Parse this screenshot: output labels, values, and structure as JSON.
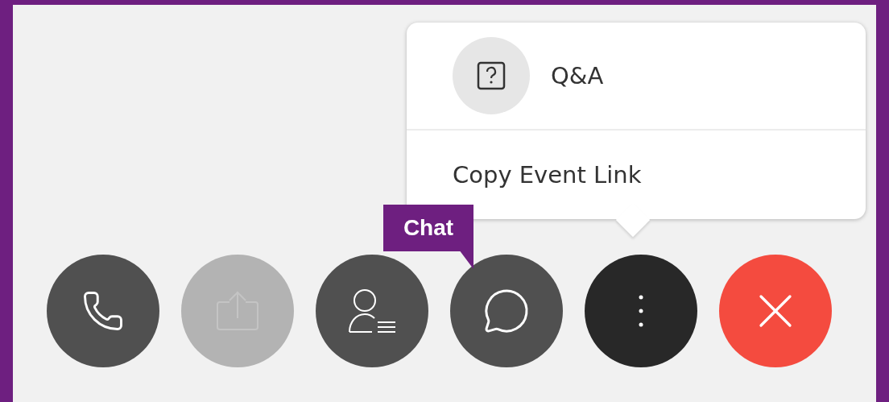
{
  "menu": {
    "items": [
      {
        "kind": "icon",
        "label": "Q&A"
      },
      {
        "kind": "plain",
        "label": "Copy Event Link"
      }
    ]
  },
  "toolbar": {
    "buttons": [
      {
        "kind": "call",
        "disabled": false,
        "selected": false
      },
      {
        "kind": "share",
        "disabled": true,
        "selected": false
      },
      {
        "kind": "participants",
        "disabled": false,
        "selected": false
      },
      {
        "kind": "chat",
        "disabled": false,
        "selected": false,
        "tooltip": "Chat"
      },
      {
        "kind": "more",
        "disabled": false,
        "selected": true
      },
      {
        "kind": "leave",
        "disabled": false,
        "selected": false
      }
    ]
  }
}
